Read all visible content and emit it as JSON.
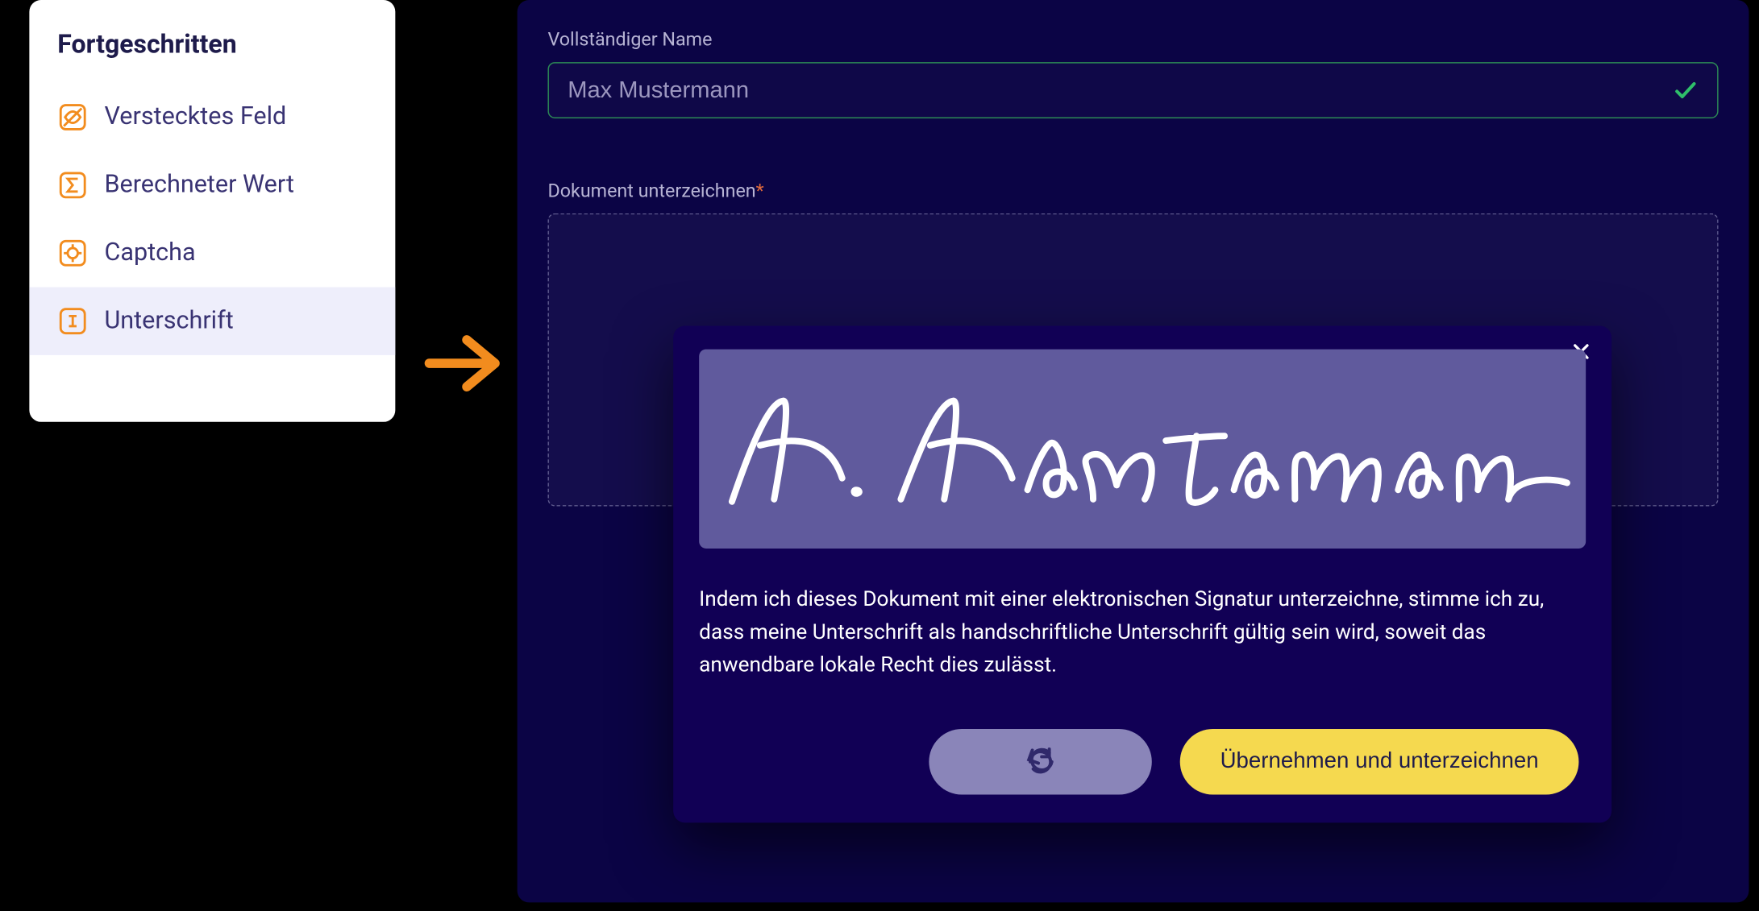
{
  "sidebar": {
    "heading": "Fortgeschritten",
    "items": [
      {
        "label": "Verstecktes Feld",
        "icon": "hidden-icon"
      },
      {
        "label": "Berechneter Wert",
        "icon": "sigma-icon"
      },
      {
        "label": "Captcha",
        "icon": "target-icon"
      },
      {
        "label": "Unterschrift",
        "icon": "signature-icon",
        "selected": true
      }
    ]
  },
  "form": {
    "name_label": "Vollständiger Name",
    "name_value": "Max Mustermann",
    "sign_label": "Dokument unterzeichnen",
    "sign_required_marker": "*"
  },
  "signature_modal": {
    "consent_text": "Indem ich dieses Dokument mit einer elektronischen Signatur unterzeichne, stimme ich zu, dass meine Unterschrift als handschriftliche Unterschrift gültig sein wird, soweit das anwendbare lokale Recht dies zulässt.",
    "apply_label": "Übernehmen und unterzeichnen",
    "reset_aria": "Zurücksetzen",
    "close_aria": "Schließen"
  },
  "colors": {
    "accent_orange": "#f28c1e",
    "accent_yellow": "#f5d94f",
    "dark_navy": "#0b0445",
    "modal_navy": "#110055",
    "sig_pad": "#605a9d",
    "success_green": "#2fbf6a"
  }
}
